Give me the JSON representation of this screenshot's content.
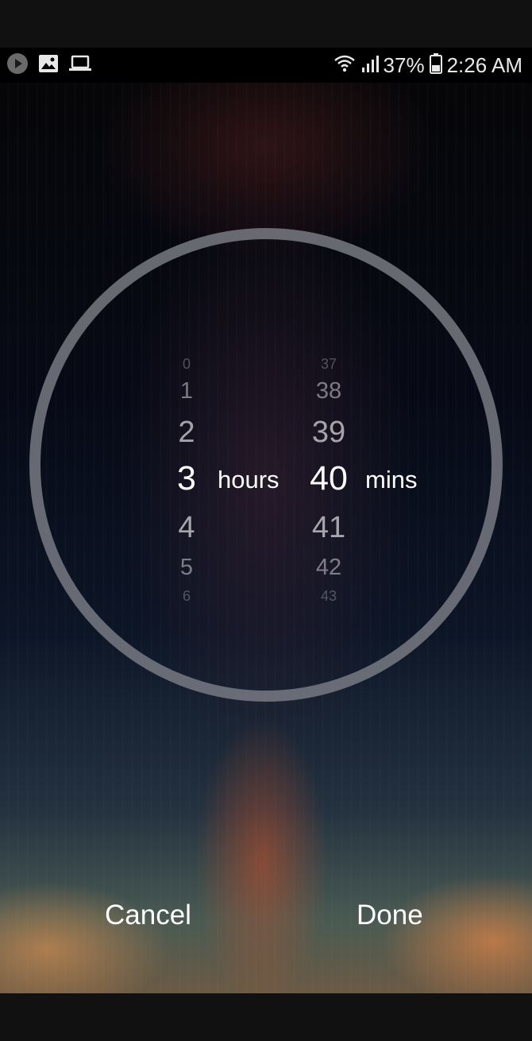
{
  "status_bar": {
    "left_icons": [
      "play-icon",
      "gallery-icon",
      "laptop-icon"
    ],
    "battery": "37%",
    "time": "2:26 AM",
    "right_icons": [
      "wifi-icon",
      "signal-icon",
      "battery-icon"
    ]
  },
  "timer_picker": {
    "hours": {
      "values": [
        "0",
        "1",
        "2",
        "3",
        "4",
        "5",
        "6"
      ],
      "selected": "3",
      "unit": "hours"
    },
    "minutes": {
      "values": [
        "37",
        "38",
        "39",
        "40",
        "41",
        "42",
        "43"
      ],
      "selected": "40",
      "unit": "mins"
    }
  },
  "actions": {
    "cancel_label": "Cancel",
    "done_label": "Done"
  },
  "colors": {
    "dial_ring": "#7a7c84",
    "text": "#ffffff"
  }
}
